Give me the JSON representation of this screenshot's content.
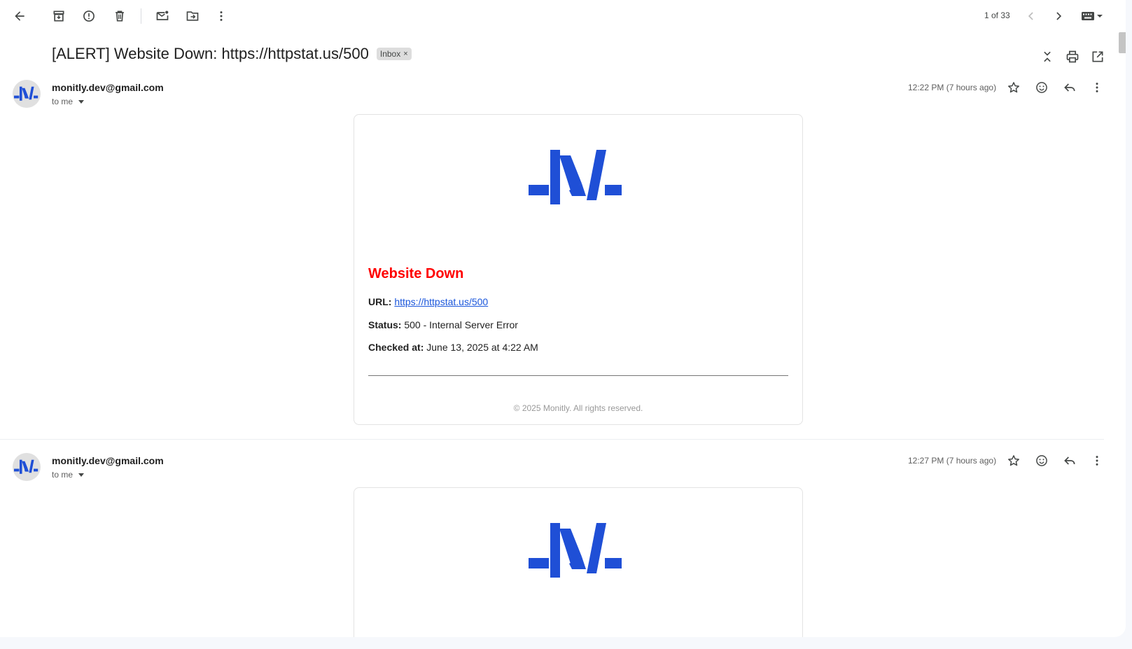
{
  "toolbar": {
    "back": "back-icon",
    "archive": "archive-icon",
    "spam": "report-spam-icon",
    "delete": "delete-icon",
    "mark_unread": "mark-unread-icon",
    "move": "move-to-icon",
    "more": "more-vert-icon",
    "pager_text": "1 of 33",
    "input_tools": "keyboard-icon"
  },
  "thread": {
    "subject": "[ALERT] Website Down: https://httpstat.us/500",
    "label": "Inbox",
    "label_remove": "×"
  },
  "messages": [
    {
      "sender": "monitly.dev@gmail.com",
      "to": "to me",
      "time": "12:22 PM (7 hours ago)",
      "alert_title": "Website Down",
      "url_label": "URL:",
      "url": "https://httpstat.us/500",
      "status_label": "Status:",
      "status": "500 - Internal Server Error",
      "checked_label": "Checked at:",
      "checked": "June 13, 2025 at 4:22 AM",
      "footer": "© 2025 Monitly. All rights reserved."
    },
    {
      "sender": "monitly.dev@gmail.com",
      "to": "to me",
      "time": "12:27 PM (7 hours ago)"
    }
  ],
  "colors": {
    "brand_blue": "#1f4fd6",
    "alert_red": "#ff0000",
    "link_blue": "#1a56db"
  }
}
